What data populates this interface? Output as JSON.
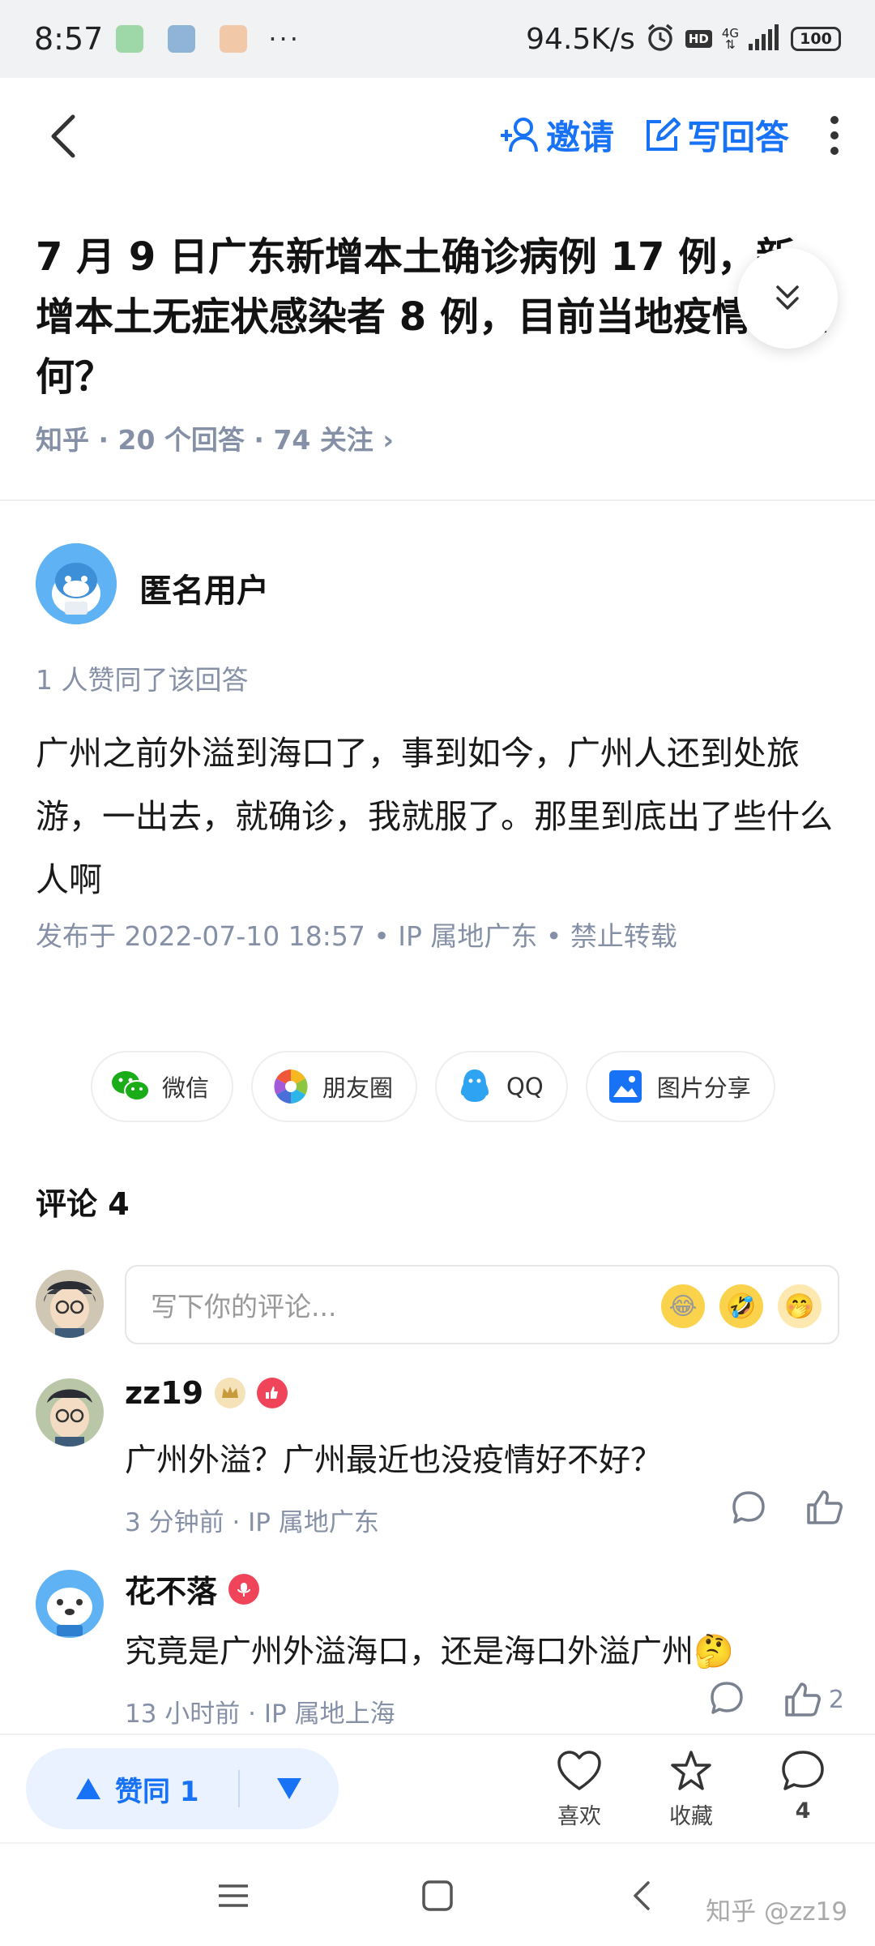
{
  "status_bar": {
    "time": "8:57",
    "dots": "···",
    "net_speed": "94.5K/s",
    "hd": "HD",
    "network": "4G",
    "battery": "100"
  },
  "nav": {
    "invite_label": "邀请",
    "write_answer_label": "写回答"
  },
  "question": {
    "title": "7 月 9 日广东新增本土确诊病例 17 例，新增本土无症状感染者 8 例，目前当地疫情况如何？",
    "meta": "知乎 · 20 个回答 · 74 关注 ›"
  },
  "answer": {
    "author": "匿名用户",
    "upvote_info": "1 人赞同了该回答",
    "body": "广州之前外溢到海口了，事到如今，广州人还到处旅游，一出去，就确诊，我就服了。那里到底出了些什么人啊",
    "meta": "发布于 2022-07-10 18:57 • IP 属地广东 • 禁止转载"
  },
  "share": [
    {
      "label": "微信",
      "icon": "wechat-icon"
    },
    {
      "label": "朋友圈",
      "icon": "moments-icon"
    },
    {
      "label": "QQ",
      "icon": "qq-icon"
    },
    {
      "label": "图片分享",
      "icon": "image-share-icon"
    }
  ],
  "comments": {
    "title": "评论 4",
    "input_placeholder": "写下你的评论...",
    "items": [
      {
        "user": "zz19",
        "text": "广州外溢？广州最近也没疫情好不好？",
        "time": "3 分钟前",
        "ip": "IP 属地广东",
        "likes": ""
      },
      {
        "user": "花不落",
        "text": "究竟是广州外溢海口，还是海口外溢广州",
        "time": "13 小时前",
        "ip": "IP 属地上海",
        "likes": "2"
      }
    ]
  },
  "bottom_bar": {
    "vote_label": "赞同 1",
    "like_label": "喜欢",
    "favorite_label": "收藏",
    "comment_count": "4"
  },
  "watermark": "知乎 @zz19",
  "colors": {
    "accent": "#1772f6",
    "meta_gray": "#8590a6",
    "vote_bg": "#eaf2ff"
  }
}
